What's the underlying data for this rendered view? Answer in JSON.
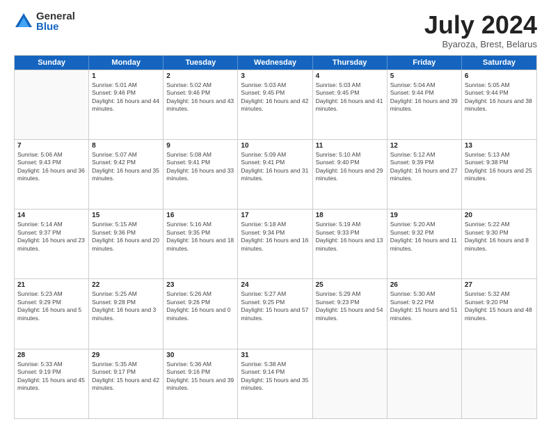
{
  "logo": {
    "general": "General",
    "blue": "Blue"
  },
  "title": "July 2024",
  "subtitle": "Byaroza, Brest, Belarus",
  "weekdays": [
    "Sunday",
    "Monday",
    "Tuesday",
    "Wednesday",
    "Thursday",
    "Friday",
    "Saturday"
  ],
  "weeks": [
    [
      {
        "day": "",
        "sunrise": "",
        "sunset": "",
        "daylight": ""
      },
      {
        "day": "1",
        "sunrise": "Sunrise: 5:01 AM",
        "sunset": "Sunset: 9:46 PM",
        "daylight": "Daylight: 16 hours and 44 minutes."
      },
      {
        "day": "2",
        "sunrise": "Sunrise: 5:02 AM",
        "sunset": "Sunset: 9:46 PM",
        "daylight": "Daylight: 16 hours and 43 minutes."
      },
      {
        "day": "3",
        "sunrise": "Sunrise: 5:03 AM",
        "sunset": "Sunset: 9:45 PM",
        "daylight": "Daylight: 16 hours and 42 minutes."
      },
      {
        "day": "4",
        "sunrise": "Sunrise: 5:03 AM",
        "sunset": "Sunset: 9:45 PM",
        "daylight": "Daylight: 16 hours and 41 minutes."
      },
      {
        "day": "5",
        "sunrise": "Sunrise: 5:04 AM",
        "sunset": "Sunset: 9:44 PM",
        "daylight": "Daylight: 16 hours and 39 minutes."
      },
      {
        "day": "6",
        "sunrise": "Sunrise: 5:05 AM",
        "sunset": "Sunset: 9:44 PM",
        "daylight": "Daylight: 16 hours and 38 minutes."
      }
    ],
    [
      {
        "day": "7",
        "sunrise": "Sunrise: 5:06 AM",
        "sunset": "Sunset: 9:43 PM",
        "daylight": "Daylight: 16 hours and 36 minutes."
      },
      {
        "day": "8",
        "sunrise": "Sunrise: 5:07 AM",
        "sunset": "Sunset: 9:42 PM",
        "daylight": "Daylight: 16 hours and 35 minutes."
      },
      {
        "day": "9",
        "sunrise": "Sunrise: 5:08 AM",
        "sunset": "Sunset: 9:41 PM",
        "daylight": "Daylight: 16 hours and 33 minutes."
      },
      {
        "day": "10",
        "sunrise": "Sunrise: 5:09 AM",
        "sunset": "Sunset: 9:41 PM",
        "daylight": "Daylight: 16 hours and 31 minutes."
      },
      {
        "day": "11",
        "sunrise": "Sunrise: 5:10 AM",
        "sunset": "Sunset: 9:40 PM",
        "daylight": "Daylight: 16 hours and 29 minutes."
      },
      {
        "day": "12",
        "sunrise": "Sunrise: 5:12 AM",
        "sunset": "Sunset: 9:39 PM",
        "daylight": "Daylight: 16 hours and 27 minutes."
      },
      {
        "day": "13",
        "sunrise": "Sunrise: 5:13 AM",
        "sunset": "Sunset: 9:38 PM",
        "daylight": "Daylight: 16 hours and 25 minutes."
      }
    ],
    [
      {
        "day": "14",
        "sunrise": "Sunrise: 5:14 AM",
        "sunset": "Sunset: 9:37 PM",
        "daylight": "Daylight: 16 hours and 23 minutes."
      },
      {
        "day": "15",
        "sunrise": "Sunrise: 5:15 AM",
        "sunset": "Sunset: 9:36 PM",
        "daylight": "Daylight: 16 hours and 20 minutes."
      },
      {
        "day": "16",
        "sunrise": "Sunrise: 5:16 AM",
        "sunset": "Sunset: 9:35 PM",
        "daylight": "Daylight: 16 hours and 18 minutes."
      },
      {
        "day": "17",
        "sunrise": "Sunrise: 5:18 AM",
        "sunset": "Sunset: 9:34 PM",
        "daylight": "Daylight: 16 hours and 16 minutes."
      },
      {
        "day": "18",
        "sunrise": "Sunrise: 5:19 AM",
        "sunset": "Sunset: 9:33 PM",
        "daylight": "Daylight: 16 hours and 13 minutes."
      },
      {
        "day": "19",
        "sunrise": "Sunrise: 5:20 AM",
        "sunset": "Sunset: 9:32 PM",
        "daylight": "Daylight: 16 hours and 11 minutes."
      },
      {
        "day": "20",
        "sunrise": "Sunrise: 5:22 AM",
        "sunset": "Sunset: 9:30 PM",
        "daylight": "Daylight: 16 hours and 8 minutes."
      }
    ],
    [
      {
        "day": "21",
        "sunrise": "Sunrise: 5:23 AM",
        "sunset": "Sunset: 9:29 PM",
        "daylight": "Daylight: 16 hours and 5 minutes."
      },
      {
        "day": "22",
        "sunrise": "Sunrise: 5:25 AM",
        "sunset": "Sunset: 9:28 PM",
        "daylight": "Daylight: 16 hours and 3 minutes."
      },
      {
        "day": "23",
        "sunrise": "Sunrise: 5:26 AM",
        "sunset": "Sunset: 9:26 PM",
        "daylight": "Daylight: 16 hours and 0 minutes."
      },
      {
        "day": "24",
        "sunrise": "Sunrise: 5:27 AM",
        "sunset": "Sunset: 9:25 PM",
        "daylight": "Daylight: 15 hours and 57 minutes."
      },
      {
        "day": "25",
        "sunrise": "Sunrise: 5:29 AM",
        "sunset": "Sunset: 9:23 PM",
        "daylight": "Daylight: 15 hours and 54 minutes."
      },
      {
        "day": "26",
        "sunrise": "Sunrise: 5:30 AM",
        "sunset": "Sunset: 9:22 PM",
        "daylight": "Daylight: 15 hours and 51 minutes."
      },
      {
        "day": "27",
        "sunrise": "Sunrise: 5:32 AM",
        "sunset": "Sunset: 9:20 PM",
        "daylight": "Daylight: 15 hours and 48 minutes."
      }
    ],
    [
      {
        "day": "28",
        "sunrise": "Sunrise: 5:33 AM",
        "sunset": "Sunset: 9:19 PM",
        "daylight": "Daylight: 15 hours and 45 minutes."
      },
      {
        "day": "29",
        "sunrise": "Sunrise: 5:35 AM",
        "sunset": "Sunset: 9:17 PM",
        "daylight": "Daylight: 15 hours and 42 minutes."
      },
      {
        "day": "30",
        "sunrise": "Sunrise: 5:36 AM",
        "sunset": "Sunset: 9:16 PM",
        "daylight": "Daylight: 15 hours and 39 minutes."
      },
      {
        "day": "31",
        "sunrise": "Sunrise: 5:38 AM",
        "sunset": "Sunset: 9:14 PM",
        "daylight": "Daylight: 15 hours and 35 minutes."
      },
      {
        "day": "",
        "sunrise": "",
        "sunset": "",
        "daylight": ""
      },
      {
        "day": "",
        "sunrise": "",
        "sunset": "",
        "daylight": ""
      },
      {
        "day": "",
        "sunrise": "",
        "sunset": "",
        "daylight": ""
      }
    ]
  ]
}
